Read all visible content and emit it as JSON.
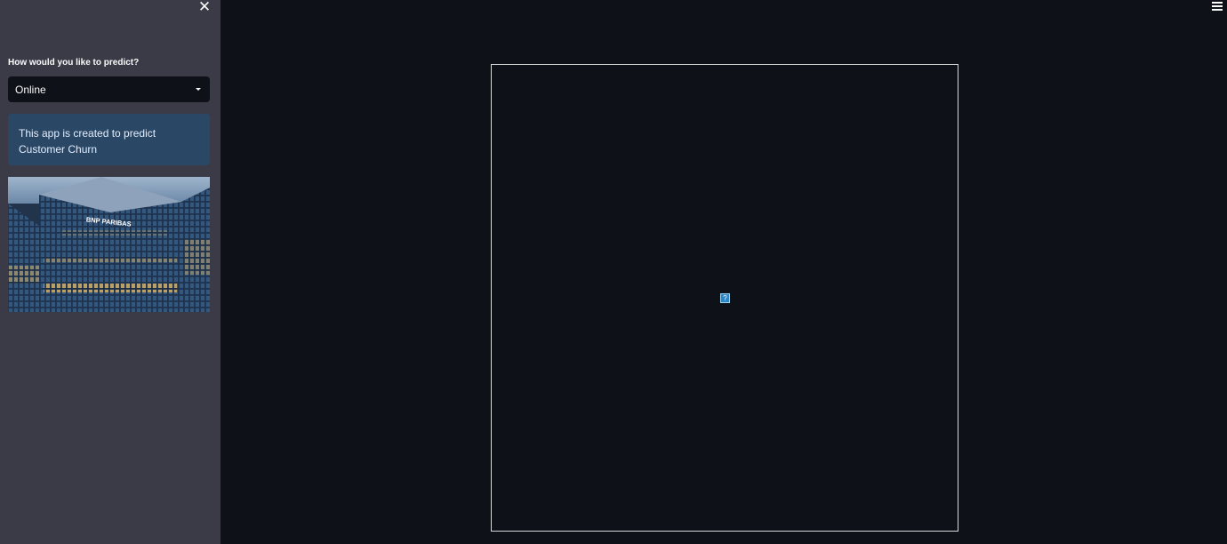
{
  "sidebar": {
    "close_icon": "close-icon",
    "select": {
      "label": "How would you like to predict?",
      "value": "Online"
    },
    "info": {
      "text": "This app is created to predict Customer Churn"
    },
    "image": {
      "sign_text": "BNP PARIBAS"
    }
  },
  "main": {
    "menu_icon": "hamburger-menu-icon",
    "broken_image_glyph": "?"
  },
  "colors": {
    "sidebar_bg": "#3a3b47",
    "main_bg": "#0e1117",
    "info_bg": "#2b4766",
    "frame_border": "#d9d9d9"
  }
}
